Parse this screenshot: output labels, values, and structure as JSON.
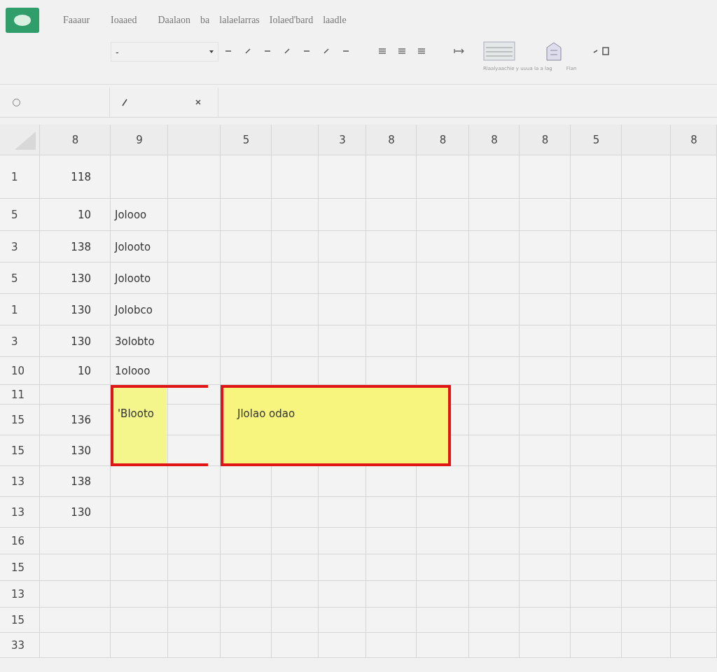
{
  "menu": [
    "Faaaur",
    "Ioaaed",
    "Daalaon",
    "ba",
    "lalaelarras",
    "Iolaed'bard",
    "laadle"
  ],
  "toolbar": {
    "font_value": "-",
    "caption_left": "Rlaalyaachie y uuua la a lag",
    "caption_right": "Flan"
  },
  "columns": [
    "8",
    "9",
    "",
    "5",
    "",
    "3",
    "8",
    "8",
    "8",
    "8",
    "5",
    "",
    "8"
  ],
  "rows": [
    {
      "header": "1",
      "cells": [
        "118",
        ""
      ]
    },
    {
      "header": "5",
      "cells": [
        "10",
        "Jolooo"
      ]
    },
    {
      "header": "3",
      "cells": [
        "138",
        "Jolooto"
      ]
    },
    {
      "header": "5",
      "cells": [
        "130",
        "Jolooto"
      ]
    },
    {
      "header": "1",
      "cells": [
        "130",
        "Jolobco"
      ]
    },
    {
      "header": "3",
      "cells": [
        "130",
        "3olobto"
      ]
    },
    {
      "header": "10",
      "cells": [
        "10",
        "1olooo"
      ]
    },
    {
      "header": "11",
      "cells": [
        "",
        ""
      ]
    },
    {
      "header": "15",
      "cells": [
        "136",
        ""
      ]
    },
    {
      "header": "15",
      "cells": [
        "130",
        ""
      ]
    },
    {
      "header": "13",
      "cells": [
        "138",
        ""
      ]
    },
    {
      "header": "13",
      "cells": [
        "130",
        ""
      ]
    },
    {
      "header": "16",
      "cells": [
        "",
        ""
      ]
    },
    {
      "header": "15",
      "cells": [
        "",
        ""
      ]
    },
    {
      "header": "13",
      "cells": [
        "",
        ""
      ]
    },
    {
      "header": "15",
      "cells": [
        "",
        ""
      ]
    },
    {
      "header": "33",
      "cells": [
        "",
        ""
      ]
    }
  ],
  "highlights": [
    {
      "text": "'Blooto"
    },
    {
      "text": "Jlolao  odao"
    }
  ]
}
